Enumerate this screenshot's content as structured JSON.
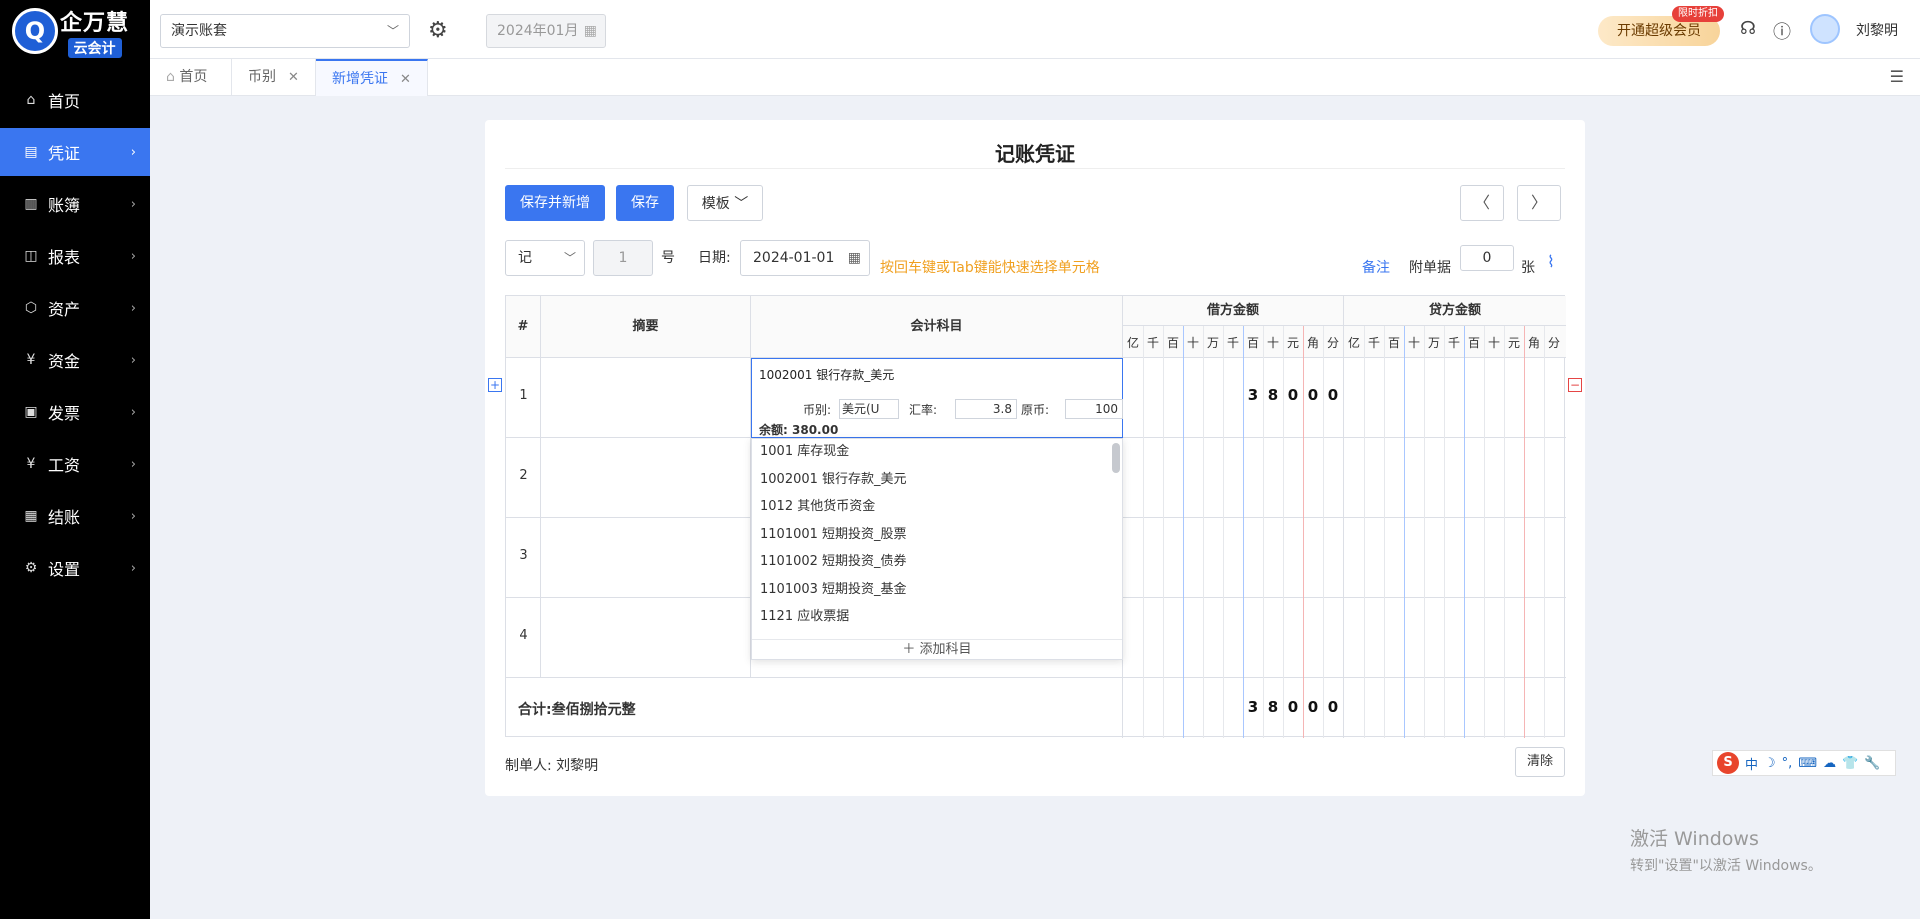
{
  "logo": {
    "circle_char": "Q",
    "line1": "企万慧",
    "line2": "云会计"
  },
  "sidebar": {
    "items": [
      {
        "label": "首页",
        "icon": "home-icon",
        "glyph": "⌂"
      },
      {
        "label": "凭证",
        "icon": "voucher-icon",
        "glyph": "▤"
      },
      {
        "label": "账簿",
        "icon": "ledger-icon",
        "glyph": "▥"
      },
      {
        "label": "报表",
        "icon": "report-icon",
        "glyph": "◫"
      },
      {
        "label": "资产",
        "icon": "asset-icon",
        "glyph": "⬡"
      },
      {
        "label": "资金",
        "icon": "fund-icon",
        "glyph": "¥"
      },
      {
        "label": "发票",
        "icon": "invoice-icon",
        "glyph": "▣"
      },
      {
        "label": "工资",
        "icon": "salary-icon",
        "glyph": "¥"
      },
      {
        "label": "结账",
        "icon": "close-account-icon",
        "glyph": "▦"
      },
      {
        "label": "设置",
        "icon": "settings-icon",
        "glyph": "⚙"
      }
    ],
    "active_index": 1
  },
  "topbar": {
    "account": "演示账套",
    "period": "2024年01月",
    "vip_label": "开通超级会员",
    "vip_badge": "限时折扣",
    "username": "刘黎明"
  },
  "tabs": [
    {
      "label": "首页"
    },
    {
      "label": "币别"
    },
    {
      "label": "新增凭证"
    }
  ],
  "voucher": {
    "title": "记账凭证",
    "btn_save_new": "保存并新增",
    "btn_save": "保存",
    "btn_template": "模板",
    "word": "记",
    "number": "1",
    "number_suffix": "号",
    "date_label": "日期:",
    "date": "2024-01-01",
    "hint": "按回车键或Tab键能快速选择单元格",
    "memo": "备注",
    "attach_label": "附单据",
    "attach_count": "0",
    "attach_unit": "张",
    "headers": {
      "index": "#",
      "summary": "摘要",
      "subject": "会计科目",
      "debit": "借方金额",
      "credit": "贷方金额"
    },
    "digits": [
      "亿",
      "千",
      "百",
      "十",
      "万",
      "千",
      "百",
      "十",
      "元",
      "角",
      "分"
    ],
    "rows": [
      {
        "n": "1",
        "subject": "1002001  银行存款_美元",
        "currency_label": "币别:",
        "currency": "美元(U",
        "rate_label": "汇率:",
        "rate": "3.8",
        "orig_label": "原币:",
        "orig": "100",
        "balance_label": "余额:",
        "balance": "380.00",
        "debit_digits": [
          "3",
          "8",
          "0",
          "0",
          "0"
        ]
      },
      {
        "n": "2"
      },
      {
        "n": "3"
      },
      {
        "n": "4"
      }
    ],
    "dropdown": [
      "1001 库存现金",
      "1002001 银行存款_美元",
      "1012 其他货币资金",
      "1101001 短期投资_股票",
      "1101002 短期投资_债券",
      "1101003 短期投资_基金",
      "1121 应收票据"
    ],
    "add_subject": "＋ 添加科目",
    "total_label": "合计:叁佰捌拾元整",
    "total_digits": [
      "3",
      "8",
      "0",
      "0",
      "0"
    ],
    "maker": "制单人:  刘黎明",
    "clear": "清除"
  },
  "ime": [
    "中",
    "☽",
    "°,",
    "⌨",
    "☁",
    "👕",
    "🔧"
  ],
  "watermark": {
    "line1": "激活 Windows",
    "line2": "转到\"设置\"以激活 Windows。"
  }
}
